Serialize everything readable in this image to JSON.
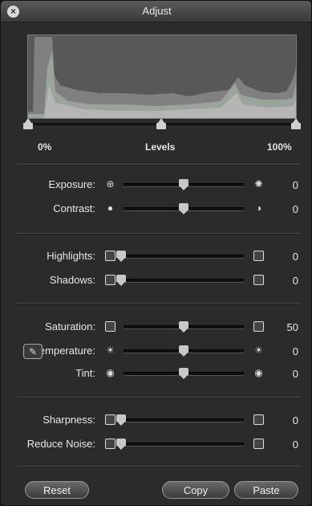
{
  "window": {
    "title": "Adjust"
  },
  "levels": {
    "left_label": "0%",
    "center_label": "Levels",
    "right_label": "100%"
  },
  "sliders": {
    "exposure": {
      "label": "Exposure:",
      "value": "0",
      "level": 0.5,
      "left_icon": "aperture-icon",
      "right_icon": "aperture-bright-icon"
    },
    "contrast": {
      "label": "Contrast:",
      "value": "0",
      "level": 0.5,
      "left_icon": "dot-icon",
      "right_icon": "half-circle-icon"
    },
    "highlights": {
      "label": "Highlights:",
      "value": "0",
      "level": 0.0,
      "left_icon": "highlights-low-icon",
      "right_icon": "highlights-high-icon"
    },
    "shadows": {
      "label": "Shadows:",
      "value": "0",
      "level": 0.0,
      "left_icon": "shadows-low-icon",
      "right_icon": "shadows-high-icon"
    },
    "saturation": {
      "label": "Saturation:",
      "value": "50",
      "level": 0.5,
      "left_icon": "saturation-low-icon",
      "right_icon": "saturation-high-icon"
    },
    "temperature": {
      "label": "Temperature:",
      "value": "0",
      "level": 0.5,
      "left_icon": "sun-cool-icon",
      "right_icon": "sun-warm-icon"
    },
    "tint": {
      "label": "Tint:",
      "value": "0",
      "level": 0.5,
      "left_icon": "tint-low-icon",
      "right_icon": "tint-high-icon"
    },
    "sharpness": {
      "label": "Sharpness:",
      "value": "0",
      "level": 0.0,
      "left_icon": "sharpness-low-icon",
      "right_icon": "sharpness-high-icon"
    },
    "reduce_noise": {
      "label": "Reduce Noise:",
      "value": "0",
      "level": 0.0,
      "left_icon": "noise-low-icon",
      "right_icon": "noise-high-icon"
    }
  },
  "buttons": {
    "reset": "Reset",
    "copy": "Copy",
    "paste": "Paste"
  },
  "colors": {
    "panel": "#2b2b2b",
    "histogram_bg": "#585858",
    "thumb": "#c8c8c8"
  }
}
